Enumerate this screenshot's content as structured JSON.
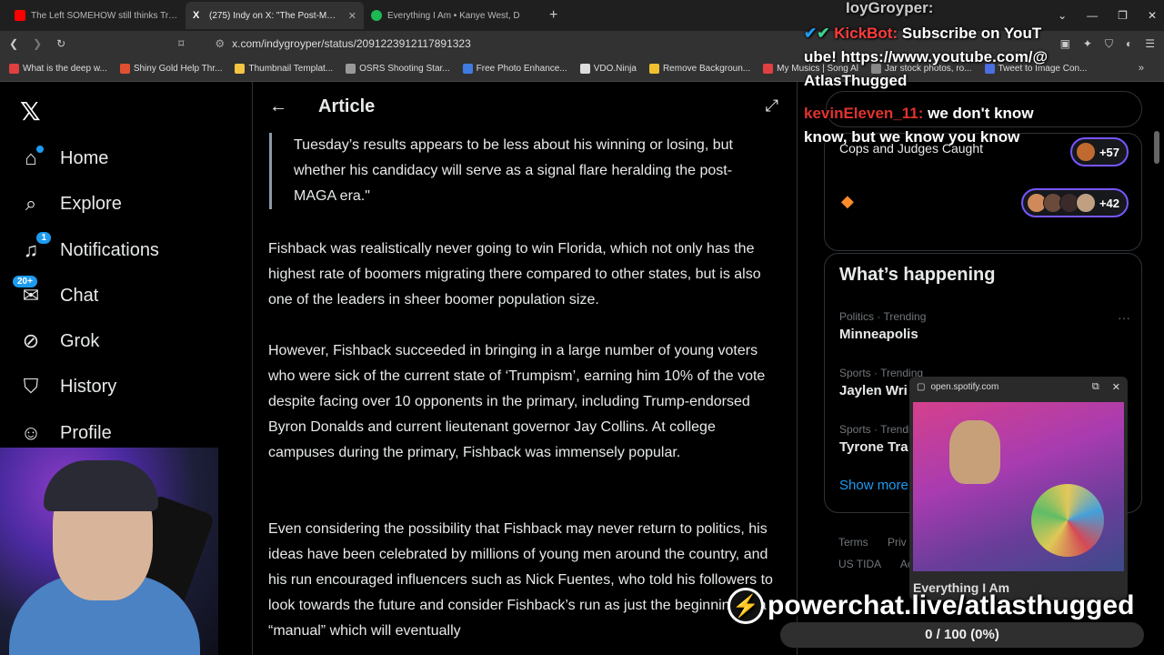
{
  "browser": {
    "tabs": [
      {
        "title": "The Left SOMEHOW still thinks Trum",
        "favicon_color": "#ff0000",
        "active": false
      },
      {
        "title": "(275) Indy on X: \"The Post-MAG",
        "favicon_color": "#ffffff",
        "active": true
      },
      {
        "title": "Everything I Am • Kanye West, D",
        "favicon_color": "#1db954",
        "active": false
      }
    ],
    "url": "x.com/indygroyper/status/2091223912117891323",
    "bookmarks": [
      {
        "label": "What is the deep w...",
        "color": "#e04040"
      },
      {
        "label": "Shiny Gold Help Thr...",
        "color": "#e05030"
      },
      {
        "label": "Thumbnail Templat...",
        "color": "#f4c542"
      },
      {
        "label": "OSRS Shooting Star...",
        "color": "#999999"
      },
      {
        "label": "Free Photo Enhance...",
        "color": "#3f7be0"
      },
      {
        "label": "VDO.Ninja",
        "color": "#dddddd"
      },
      {
        "label": "Remove Backgroun...",
        "color": "#f0c030"
      },
      {
        "label": "My Musics | Song Al",
        "color": "#e04040"
      },
      {
        "label": "Jar stock photos, ro...",
        "color": "#888888"
      },
      {
        "label": "Tweet to Image Con...",
        "color": "#4a6fe0"
      }
    ]
  },
  "nav": {
    "items": [
      {
        "label": "Home",
        "icon": "home-icon"
      },
      {
        "label": "Explore",
        "icon": "search-icon"
      },
      {
        "label": "Notifications",
        "icon": "bell-icon",
        "badge": "1"
      },
      {
        "label": "Chat",
        "icon": "chat-icon",
        "badge": "20+"
      },
      {
        "label": "Grok",
        "icon": "grok-icon"
      },
      {
        "label": "History",
        "icon": "bookmark-icon"
      },
      {
        "label": "Profile",
        "icon": "person-icon"
      }
    ]
  },
  "article": {
    "header_title": "Article",
    "quote": "Tuesday’s results appears to be less about his winning or losing, but whether his candidacy will serve as a signal flare heralding the post-MAGA era.\"",
    "paragraphs": [
      "Fishback was realistically never going to win Florida, which not only has the highest rate of boomers migrating there compared to other states, but is also one of the leaders in sheer boomer population size.",
      "However, Fishback succeeded in bringing in a large number of young voters who were sick of the current state of ‘Trumpism’, earning him 10% of the vote despite facing over 10 opponents in the primary, including Trump-endorsed Byron Donalds and current lieutenant governor Jay Collins. At college campuses during the primary, Fishback was immensely popular.",
      "Even considering the possibility that Fishback may never return to politics, his ideas have been celebrated by millions of young men around the country, and his run encouraged influencers such as Nick Fuentes, who told his followers to look towards the future and consider Fishback’s run as just the beginning of a “manual” which will eventually"
    ]
  },
  "right": {
    "live_text": "Cops and Judges Caught",
    "live_counts": [
      "+57",
      "+42"
    ],
    "happening_title": "What’s happening",
    "trends": [
      {
        "meta": "Politics · Trending",
        "name": "Minneapolis"
      },
      {
        "meta": "Sports · Trending",
        "name": "Jaylen Wri"
      },
      {
        "meta": "Sports · Trending",
        "name": "Tyrone Tra"
      }
    ],
    "show_more": "Show more",
    "footer": [
      "Terms",
      "Priv",
      "US TIDA",
      "Ac"
    ]
  },
  "overlay": {
    "top_name": "IoyGroyper:",
    "kick_name": "KickBot:",
    "kick_msg": "Subscribe on YouTube! https://www.youtube.com/@AtlasThugged",
    "kevin_name": "kevinEleven_11:",
    "kevin_msg": "we don't know know, but we know you know",
    "spotify_domain": "open.spotify.com",
    "spotify_title": "Everything I Am",
    "powerchat": "powerchat.live/atlasthugged",
    "progress_text": "0 / 100 (0%)",
    "progress_fraction": 0
  }
}
